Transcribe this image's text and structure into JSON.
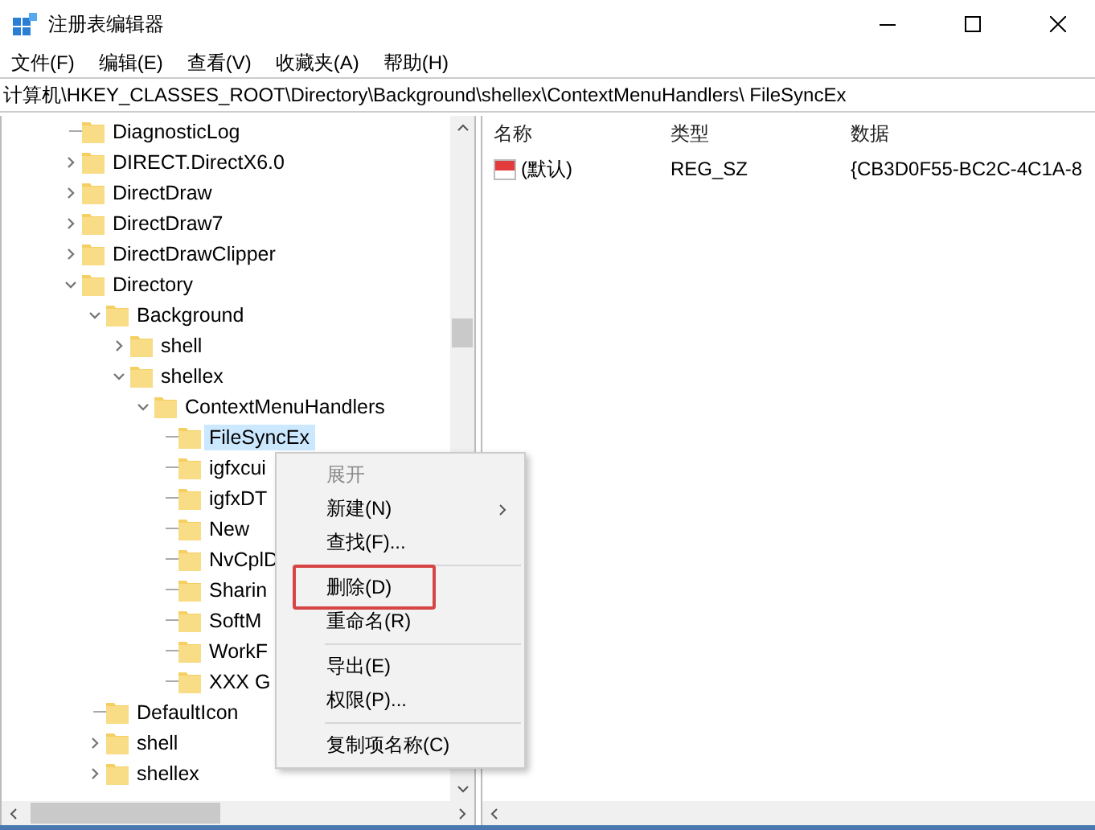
{
  "window": {
    "title": "注册表编辑器"
  },
  "menu_bar": [
    "文件(F)",
    "编辑(E)",
    "查看(V)",
    "收藏夹(A)",
    "帮助(H)"
  ],
  "address": "计算机\\HKEY_CLASSES_ROOT\\Directory\\Background\\shellex\\ContextMenuHandlers\\ FileSyncEx",
  "tree": [
    {
      "name": "DiagnosticLog",
      "selected": false
    },
    {
      "name": "DIRECT.DirectX6.0",
      "expanded": false,
      "selected": false
    },
    {
      "name": "DirectDraw",
      "expanded": false,
      "selected": false
    },
    {
      "name": "DirectDraw7",
      "expanded": false,
      "selected": false
    },
    {
      "name": "DirectDrawClipper",
      "expanded": false,
      "selected": false
    },
    {
      "name": "Directory",
      "expanded": true,
      "selected": false,
      "children": [
        {
          "name": "Background",
          "expanded": true,
          "selected": false,
          "children": [
            {
              "name": "shell",
              "expanded": false,
              "selected": false
            },
            {
              "name": "shellex",
              "expanded": true,
              "selected": false,
              "children": [
                {
                  "name": "ContextMenuHandlers",
                  "expanded": true,
                  "selected": false,
                  "children": [
                    {
                      "name": "FileSyncEx",
                      "selected": true
                    },
                    {
                      "name": "igfxcui",
                      "selected": false
                    },
                    {
                      "name": "igfxDT",
                      "selected": false
                    },
                    {
                      "name": "New",
                      "selected": false
                    },
                    {
                      "name": "NvCplD",
                      "selected": false
                    },
                    {
                      "name": "Sharin",
                      "selected": false
                    },
                    {
                      "name": "SoftM",
                      "selected": false
                    },
                    {
                      "name": "WorkF",
                      "selected": false
                    },
                    {
                      "name": "XXX G",
                      "selected": false
                    }
                  ]
                }
              ]
            }
          ]
        },
        {
          "name": "DefaultIcon",
          "selected": false
        },
        {
          "name": "shell",
          "expanded": false,
          "selected": false
        },
        {
          "name": "shellex",
          "expanded": false,
          "selected": false
        }
      ]
    }
  ],
  "values": {
    "columns": [
      "名称",
      "类型",
      "数据"
    ],
    "rows": [
      {
        "name": "(默认)",
        "type": "REG_SZ",
        "data": "{CB3D0F55-BC2C-4C1A-8"
      }
    ]
  },
  "context_menu": [
    {
      "kind": "item",
      "label": "展开",
      "disabled": true,
      "submenu": false
    },
    {
      "kind": "item",
      "label": "新建(N)",
      "disabled": false,
      "submenu": true
    },
    {
      "kind": "item",
      "label": "查找(F)...",
      "disabled": false,
      "submenu": false
    },
    {
      "kind": "separator"
    },
    {
      "kind": "item",
      "label": "删除(D)",
      "disabled": false,
      "submenu": false,
      "highlighted": true
    },
    {
      "kind": "item",
      "label": "重命名(R)",
      "disabled": false,
      "submenu": false
    },
    {
      "kind": "separator"
    },
    {
      "kind": "item",
      "label": "导出(E)",
      "disabled": false,
      "submenu": false
    },
    {
      "kind": "item",
      "label": "权限(P)...",
      "disabled": false,
      "submenu": false
    },
    {
      "kind": "separator"
    },
    {
      "kind": "item",
      "label": "复制项名称(C)",
      "disabled": false,
      "submenu": false
    }
  ]
}
